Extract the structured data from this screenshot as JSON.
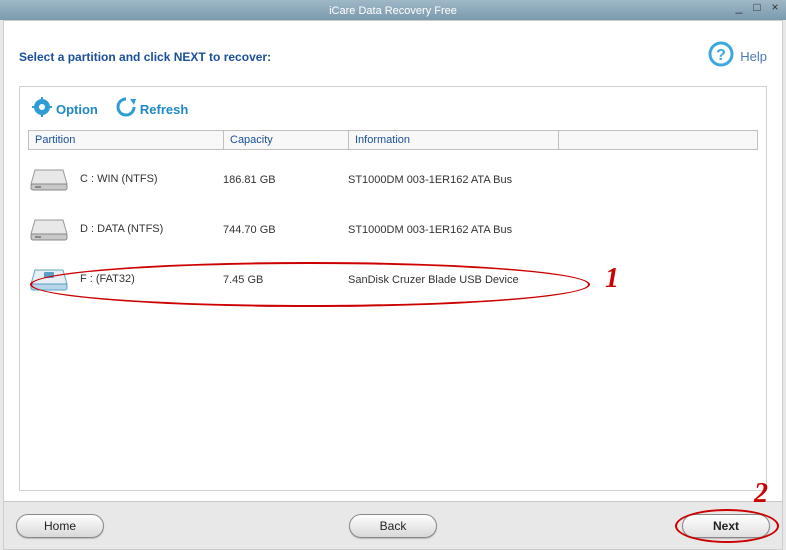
{
  "title": "iCare Data Recovery Free",
  "instruction": "Select a partition and click NEXT to recover:",
  "help_label": "Help",
  "toolbar": {
    "option_label": "Option",
    "refresh_label": "Refresh"
  },
  "columns": {
    "partition": "Partition",
    "capacity": "Capacity",
    "information": "Information"
  },
  "drives": [
    {
      "name": "C : WIN  (NTFS)",
      "capacity": "186.81 GB",
      "info": "ST1000DM  003-1ER162  ATA Bus",
      "removable": false
    },
    {
      "name": "D : DATA (NTFS)",
      "capacity": "744.70 GB",
      "info": "ST1000DM  003-1ER162  ATA Bus",
      "removable": false
    },
    {
      "name": "F :  (FAT32)",
      "capacity": "7.45 GB",
      "info": "SanDisk  Cruzer Blade  USB Device",
      "removable": true
    }
  ],
  "buttons": {
    "home": "Home",
    "back": "Back",
    "next": "Next"
  },
  "annotations": {
    "mark1": "1",
    "mark2": "2"
  }
}
